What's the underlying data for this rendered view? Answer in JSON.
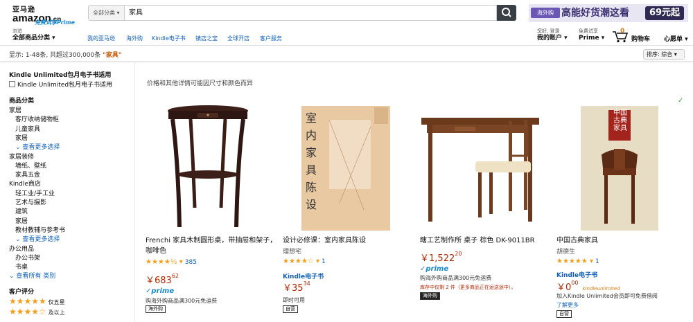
{
  "header": {
    "logo_cn": "亚马逊",
    "logo_en": "amazon",
    "logo_suffix": ".cn",
    "logo_prime": "免费试享Prime",
    "search_category": "全部分类",
    "search_value": "家具",
    "promo_tag": "海外购",
    "promo_text": "高能好货潮这看",
    "promo_price": "69元起"
  },
  "nav": {
    "browse_small": "浏览",
    "browse_label": "全部商品分类",
    "links": [
      "我的亚马逊",
      "海外购",
      "Kindle电子书",
      "镇店之宝",
      "全球开店",
      "客户服务"
    ],
    "account_small": "您好, 登录",
    "account_label": "我的账户",
    "prime_small": "免费试享",
    "prime_label": "Prime",
    "cart_count": "0",
    "cart_label": "购物车",
    "wishlist_label": "心愿单"
  },
  "results": {
    "text": "显示:  1-48条,  共超过300,000条 ",
    "query": "\"家具\"",
    "sort_label": "排序: 综合"
  },
  "sidebar": {
    "ku_heading": "Kindle Unlimited包月电子书适用",
    "ku_checkbox": "Kindle Unlimited包月电子书适用",
    "cat_heading": "商品分类",
    "cat_items": [
      {
        "label": "家居",
        "indent": 0
      },
      {
        "label": "客厅收纳储物柜",
        "indent": 1
      },
      {
        "label": "儿童家具",
        "indent": 1
      },
      {
        "label": "家居",
        "indent": 1
      },
      {
        "label": "查看更多选择",
        "indent": 1,
        "more": true
      },
      {
        "label": "家居装修",
        "indent": 0
      },
      {
        "label": "墙纸、壁纸",
        "indent": 1
      },
      {
        "label": "家具五金",
        "indent": 1
      },
      {
        "label": "Kindle商店",
        "indent": 0
      },
      {
        "label": "轻工业/手工业",
        "indent": 1
      },
      {
        "label": "艺术与摄影",
        "indent": 1
      },
      {
        "label": "建筑",
        "indent": 1
      },
      {
        "label": "家居",
        "indent": 1
      },
      {
        "label": "教材教辅与参考书",
        "indent": 1
      },
      {
        "label": "查看更多选择",
        "indent": 1,
        "more": true
      },
      {
        "label": "办公用品",
        "indent": 0
      },
      {
        "label": "办公书架",
        "indent": 1
      },
      {
        "label": "书桌",
        "indent": 1
      },
      {
        "label": "查看所有 类别",
        "indent": 0,
        "more": true
      }
    ],
    "review_heading": "客户评分",
    "review_rows": [
      {
        "stars": "★★★★★",
        "label": "仅五星"
      },
      {
        "stars": "★★★★☆",
        "label": "及以上"
      }
    ]
  },
  "notice": "价格和其他详情可能因尺寸和颜色而异",
  "products": [
    {
      "title": "Frenchi 家具木制圆形桌，带抽屉和架子，咖啡色",
      "stars": "★★★★½",
      "rating_count": "385",
      "price_int": "683",
      "price_dec": "62",
      "prime": "prime",
      "shipping": "购海外购商品满300元免运费",
      "badge": "海外购"
    },
    {
      "title": "设计必修课：室内家具陈设",
      "author": "理想宅",
      "stars": "★★★★☆",
      "rating_count": "1",
      "kindle": "Kindle电子书",
      "price_int": "35",
      "price_dec": "34",
      "availability": "即时可用",
      "badge": "自营",
      "cover_text": "室内家具陈设"
    },
    {
      "title": "瞎工艺制作所 桌子 棕色 DK-9011BR",
      "price_int": "1,522",
      "price_dec": "20",
      "prime": "prime",
      "shipping": "购海外购商品满300元免运费",
      "stock": "库存中仅剩 2 件（更多商品正在运送途中）。",
      "badge": "海外购"
    },
    {
      "title": "中国古典家具",
      "author": "胡德生",
      "stars": "★★★★★",
      "rating_count": "1",
      "kindle": "Kindle电子书",
      "price_int": "0",
      "price_dec": "00",
      "ku": "kindleunlimited",
      "ku_text": "加入Kindle Unlimited会员即可免费借阅",
      "more": "了解更多",
      "badge": "自营",
      "cover_text": "中国古典家具"
    }
  ],
  "colors": {
    "price": "#b12704",
    "link": "#0f5fb8",
    "star": "#f79c15",
    "prime": "#1a8ad0"
  }
}
